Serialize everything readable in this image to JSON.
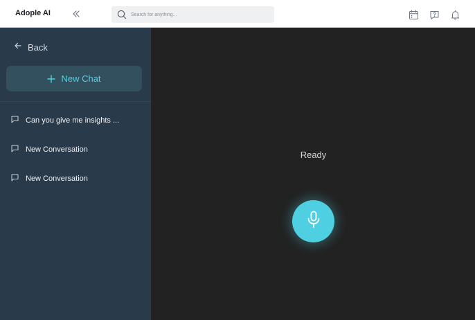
{
  "header": {
    "brand": "Adople AI",
    "search_placeholder": "Search for anything..."
  },
  "icons": {
    "collapse": "chevrons-left-icon",
    "search": "search-icon",
    "calendar": "calendar-icon",
    "help": "help-icon",
    "notifications": "bell-icon",
    "back": "arrow-left-icon",
    "new_chat": "plus-icon",
    "conversation": "chat-bubble-icon",
    "microphone": "microphone-icon"
  },
  "sidebar": {
    "back_label": "Back",
    "new_chat_label": "New Chat",
    "conversations": [
      {
        "label": "Can you give me insights ..."
      },
      {
        "label": "New Conversation"
      },
      {
        "label": "New Conversation"
      }
    ]
  },
  "main": {
    "status": "Ready"
  },
  "colors": {
    "accent": "#4fd0e2",
    "sidebar_bg": "#293a4b",
    "main_bg": "#222222",
    "new_chat_bg": "#33505f"
  }
}
